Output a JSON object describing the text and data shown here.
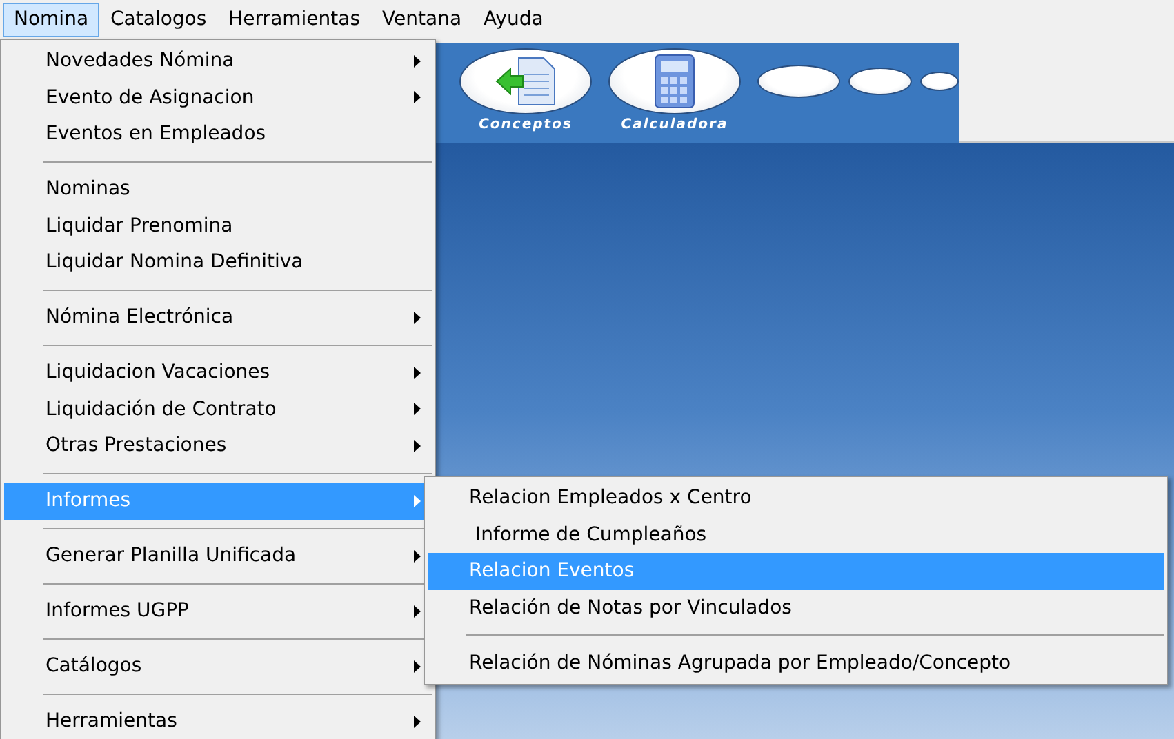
{
  "menubar": [
    {
      "label": "Nomina",
      "selected": true
    },
    {
      "label": "Catalogos",
      "selected": false
    },
    {
      "label": "Herramientas",
      "selected": false
    },
    {
      "label": "Ventana",
      "selected": false
    },
    {
      "label": "Ayuda",
      "selected": false
    }
  ],
  "toolbar": {
    "buttons": [
      {
        "label": "Conceptos",
        "kind": "document"
      },
      {
        "label": "Calculadora",
        "kind": "calculator"
      }
    ]
  },
  "menu": {
    "items": [
      {
        "kind": "item",
        "label": "Novedades Nómina",
        "submenu": true,
        "selected": false
      },
      {
        "kind": "item",
        "label": "Evento de Asignacion",
        "submenu": true,
        "selected": false
      },
      {
        "kind": "item",
        "label": "Eventos en Empleados",
        "submenu": false,
        "selected": false
      },
      {
        "kind": "separator"
      },
      {
        "kind": "item",
        "label": "Nominas",
        "submenu": false,
        "selected": false
      },
      {
        "kind": "item",
        "label": "Liquidar Prenomina",
        "submenu": false,
        "selected": false
      },
      {
        "kind": "item",
        "label": "Liquidar Nomina Definitiva",
        "submenu": false,
        "selected": false
      },
      {
        "kind": "separator"
      },
      {
        "kind": "item",
        "label": "Nómina Electrónica",
        "submenu": true,
        "selected": false
      },
      {
        "kind": "separator"
      },
      {
        "kind": "item",
        "label": "Liquidacion Vacaciones",
        "submenu": true,
        "selected": false
      },
      {
        "kind": "item",
        "label": "Liquidación de Contrato",
        "submenu": true,
        "selected": false
      },
      {
        "kind": "item",
        "label": "Otras Prestaciones",
        "submenu": true,
        "selected": false
      },
      {
        "kind": "separator"
      },
      {
        "kind": "item",
        "label": "Informes",
        "submenu": true,
        "selected": true
      },
      {
        "kind": "separator"
      },
      {
        "kind": "item",
        "label": "Generar Planilla Unificada",
        "submenu": true,
        "selected": false
      },
      {
        "kind": "separator"
      },
      {
        "kind": "item",
        "label": "Informes UGPP",
        "submenu": true,
        "selected": false
      },
      {
        "kind": "separator"
      },
      {
        "kind": "item",
        "label": "Catálogos",
        "submenu": true,
        "selected": false
      },
      {
        "kind": "separator"
      },
      {
        "kind": "item",
        "label": "Herramientas",
        "submenu": true,
        "selected": false
      }
    ]
  },
  "submenu": {
    "items": [
      {
        "kind": "item",
        "label": "Relacion Empleados x Centro",
        "selected": false
      },
      {
        "kind": "item",
        "label": " Informe de Cumpleaños",
        "selected": false
      },
      {
        "kind": "item",
        "label": "Relacion Eventos",
        "selected": true
      },
      {
        "kind": "item",
        "label": "Relación de Notas por Vinculados",
        "selected": false
      },
      {
        "kind": "separator"
      },
      {
        "kind": "item",
        "label": "Relación de Nóminas Agrupada por Empleado/Concepto",
        "selected": false
      }
    ]
  }
}
